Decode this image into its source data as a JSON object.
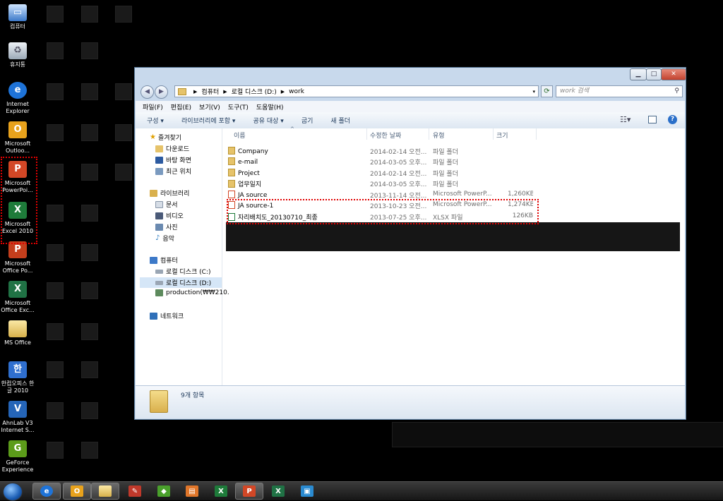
{
  "desktop_icons": [
    {
      "label": "컴퓨터",
      "icon": "computer-icon"
    },
    {
      "label": "휴지통",
      "icon": "recycle-bin-icon"
    },
    {
      "label": "Internet Explorer",
      "icon": "internet-explorer-icon"
    },
    {
      "label": "Microsoft Outloo...",
      "icon": "outlook-icon"
    },
    {
      "label": "Microsoft PowerPoi...",
      "icon": "powerpoint-icon"
    },
    {
      "label": "Microsoft Excel 2010",
      "icon": "excel-icon"
    },
    {
      "label": "Microsoft Office Po...",
      "icon": "office-powerpoint-icon"
    },
    {
      "label": "Microsoft Office Exc...",
      "icon": "office-excel-icon"
    },
    {
      "label": "MS Office",
      "icon": "folder-icon"
    },
    {
      "label": "한컴오피스 한글 2010",
      "icon": "hancom-office-icon"
    },
    {
      "label": "AhnLab V3 Internet S...",
      "icon": "ahnlab-v3-icon"
    },
    {
      "label": "GeForce Experience",
      "icon": "geforce-icon"
    }
  ],
  "window": {
    "breadcrumb": [
      "컴퓨터",
      "로컬 디스크 (D:)",
      "work"
    ],
    "search_placeholder": "work 검색",
    "menu": [
      "파일(F)",
      "편집(E)",
      "보기(V)",
      "도구(T)",
      "도움말(H)"
    ],
    "toolbar": [
      "구성 ▾",
      "라이브러리에 포함 ▾",
      "공유 대상 ▾",
      "굽기",
      "새 폴더"
    ],
    "nav": {
      "favorites": {
        "label": "즐겨찾기",
        "items": [
          "다운로드",
          "바탕 화면",
          "최근 위치"
        ]
      },
      "libraries": {
        "label": "라이브러리",
        "items": [
          "문서",
          "비디오",
          "사진",
          "음악"
        ]
      },
      "computer": {
        "label": "컴퓨터",
        "items": [
          "로컬 디스크 (C:)",
          "로컬 디스크 (D:)",
          "production(₩₩210."
        ]
      },
      "network": {
        "label": "네트워크"
      }
    },
    "columns": {
      "name": "이름",
      "date": "수정한 날짜",
      "type": "유형",
      "size": "크기"
    },
    "files": [
      {
        "name": "Company",
        "date": "2014-02-14 오전...",
        "type": "파일 폴더",
        "size": "",
        "kind": "folder"
      },
      {
        "name": "e-mail",
        "date": "2014-03-05 오후...",
        "type": "파일 폴더",
        "size": "",
        "kind": "folder"
      },
      {
        "name": "Project",
        "date": "2014-02-14 오전...",
        "type": "파일 폴더",
        "size": "",
        "kind": "folder"
      },
      {
        "name": "업무일지",
        "date": "2014-03-05 오후...",
        "type": "파일 폴더",
        "size": "",
        "kind": "folder"
      },
      {
        "name": "JA source",
        "date": "2013-11-14 오전...",
        "type": "Microsoft PowerP...",
        "size": "1,260KB",
        "kind": "ppt"
      },
      {
        "name": "JA source-1",
        "date": "2013-10-23 오전...",
        "type": "Microsoft PowerP...",
        "size": "1,274KB",
        "kind": "ppt"
      },
      {
        "name": "자리배치도_20130710_최종",
        "date": "2013-07-25 오후...",
        "type": "XLSX 파일",
        "size": "126KB",
        "kind": "xlsx"
      }
    ],
    "status": "9개 항목"
  },
  "colors": {
    "highlight": "#e00000",
    "folder": "#e6c36a"
  }
}
